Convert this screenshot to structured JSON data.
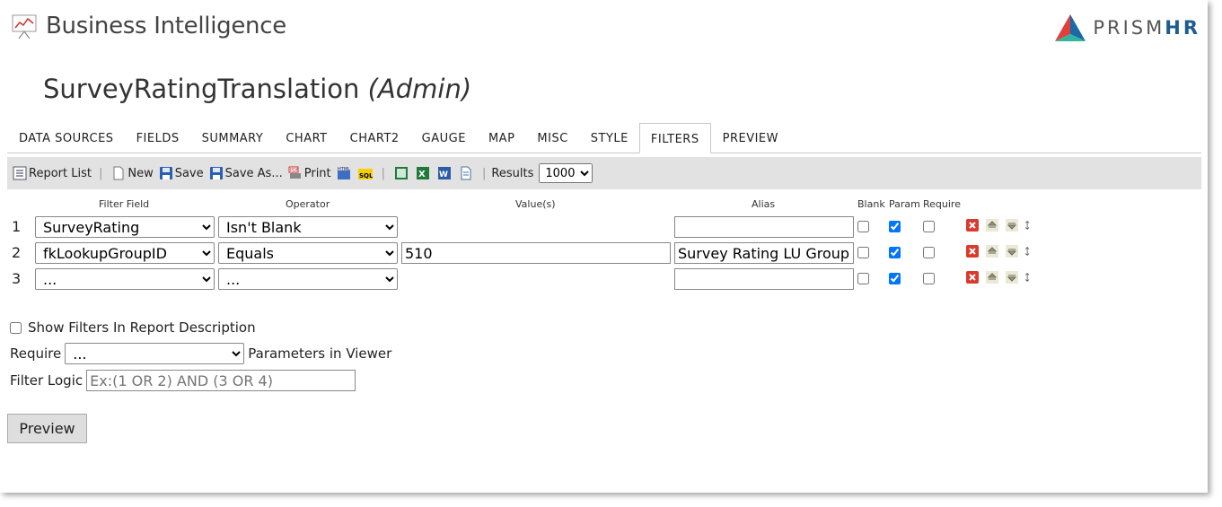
{
  "header": {
    "app_title": "Business Intelligence",
    "brand_prefix": "PRISM",
    "brand_suffix": "HR"
  },
  "report": {
    "name": "SurveyRatingTranslation",
    "role": "(Admin)"
  },
  "tabs": [
    "DATA SOURCES",
    "FIELDS",
    "SUMMARY",
    "CHART",
    "CHART2",
    "GAUGE",
    "MAP",
    "MISC",
    "STYLE",
    "FILTERS",
    "PREVIEW"
  ],
  "active_tab": "FILTERS",
  "toolbar": {
    "report_list": "Report List",
    "new": "New",
    "save": "Save",
    "save_as": "Save As...",
    "print": "Print",
    "results_label": "Results",
    "results_value": "1000"
  },
  "columns": {
    "filter_field": "Filter Field",
    "operator": "Operator",
    "values": "Value(s)",
    "alias": "Alias",
    "blank": "Blank",
    "param": "Param",
    "require": "Require"
  },
  "filters": [
    {
      "num": "1",
      "field": "SurveyRating",
      "operator": "Isn't Blank",
      "value": "",
      "alias": "",
      "blank": false,
      "param": true,
      "require": false
    },
    {
      "num": "2",
      "field": "fkLookupGroupID",
      "operator": "Equals",
      "value": "510",
      "alias": "Survey Rating LU Group",
      "blank": false,
      "param": true,
      "require": false
    },
    {
      "num": "3",
      "field": "...",
      "operator": "...",
      "value": "",
      "alias": "",
      "blank": false,
      "param": true,
      "require": false
    }
  ],
  "options": {
    "show_filters_label": "Show Filters In Report Description",
    "require_label": "Require",
    "require_value": "...",
    "parameters_label": "Parameters in Viewer",
    "logic_label": "Filter Logic",
    "logic_placeholder": "Ex:(1 OR 2) AND (3 OR 4)"
  },
  "preview_button": "Preview"
}
